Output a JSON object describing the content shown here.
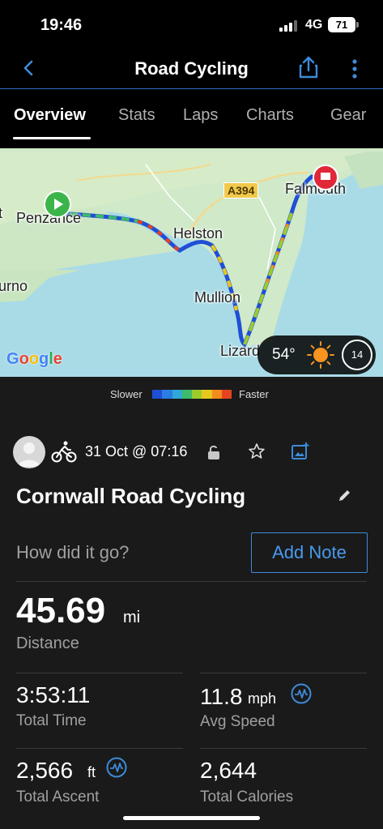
{
  "status_bar": {
    "time": "19:46",
    "network": "4G",
    "battery": "71"
  },
  "header": {
    "title": "Road Cycling",
    "back_icon": "chevron-left-icon",
    "share_icon": "share-icon",
    "more_icon": "more-vertical-icon"
  },
  "tabs": [
    {
      "label": "Overview",
      "active": true
    },
    {
      "label": "Stats",
      "active": false
    },
    {
      "label": "Laps",
      "active": false
    },
    {
      "label": "Charts",
      "active": false
    },
    {
      "label": "Gear",
      "active": false
    }
  ],
  "map": {
    "places": {
      "penzance": "Penzance",
      "helston": "Helston",
      "falmouth": "Falmouth",
      "mullion": "Mullion",
      "lizard": "Lizard",
      "left_edge_top": "t",
      "left_edge_bottom": "urno"
    },
    "road": "A394",
    "attribution": "Google",
    "weather": {
      "temperature": "54°",
      "condition_icon": "sun-icon",
      "wind": "14"
    }
  },
  "speed_legend": {
    "slower": "Slower",
    "faster": "Faster",
    "colors": [
      "#1f4fd6",
      "#2a7de1",
      "#2fa8d8",
      "#3dbb6a",
      "#9ccc2c",
      "#e8c81e",
      "#f28c1c",
      "#e6441f"
    ]
  },
  "activity": {
    "date": "31 Oct @ 07:16",
    "title": "Cornwall Road Cycling",
    "prompt": "How did it go?",
    "add_note": "Add Note",
    "distance": {
      "value": "45.69",
      "unit": "mi",
      "label": "Distance"
    },
    "stats": [
      {
        "value": "3:53:11",
        "unit": "",
        "label": "Total Time"
      },
      {
        "value": "11.8",
        "unit": "mph",
        "label": "Avg Speed"
      },
      {
        "value": "2,566",
        "unit": "ft",
        "label": "Total Ascent"
      },
      {
        "value": "2,644",
        "unit": "",
        "label": "Total Calories"
      }
    ]
  }
}
